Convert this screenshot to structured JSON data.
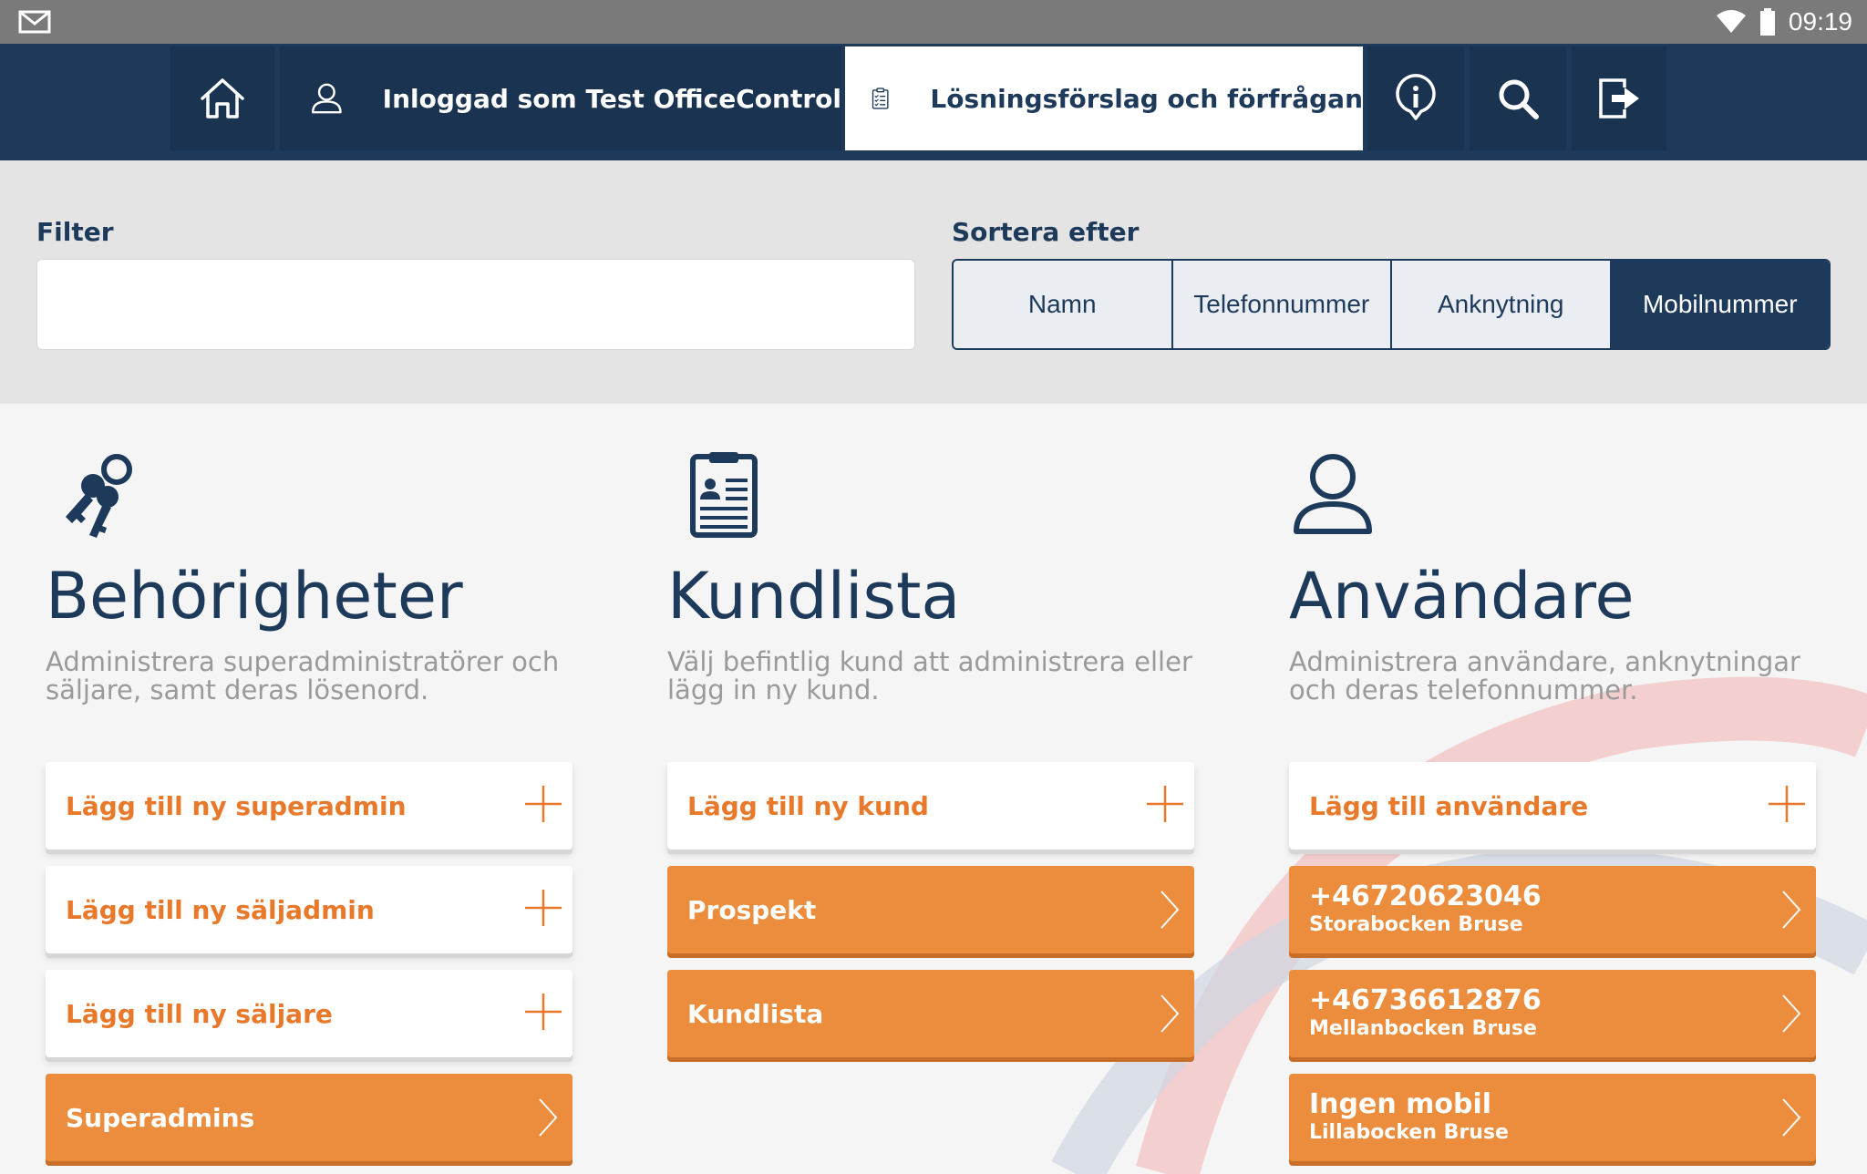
{
  "statusbar": {
    "time": "09:19"
  },
  "nav": {
    "user_label": "Inloggad som Test OfficeControl",
    "active_label": "Lösningsförslag och förfrågan"
  },
  "filter": {
    "label": "Filter",
    "value": "",
    "placeholder": ""
  },
  "sort": {
    "label": "Sortera efter",
    "options": [
      "Namn",
      "Telefonnummer",
      "Anknytning",
      "Mobilnummer"
    ],
    "selected": "Mobilnummer"
  },
  "columns": [
    {
      "title": "Behörigheter",
      "description": "Administrera superadministratörer och säljare, samt deras lösenord.",
      "items": [
        {
          "label": "Lägg till ny superadmin"
        },
        {
          "label": "Lägg till ny säljadmin"
        },
        {
          "label": "Lägg till ny säljare"
        },
        {
          "label": "Superadmins"
        }
      ]
    },
    {
      "title": "Kundlista",
      "description": "Välj befintlig kund att administrera eller lägg in ny kund.",
      "items": [
        {
          "label": "Lägg till ny kund"
        },
        {
          "label": "Prospekt"
        },
        {
          "label": "Kundlista"
        }
      ]
    },
    {
      "title": "Användare",
      "description": "Administrera användare, anknytningar och deras telefonnummer.",
      "items": [
        {
          "label": "Lägg till användare"
        },
        {
          "line1": "+46720623046",
          "line2": "Storabocken Bruse"
        },
        {
          "line1": "+46736612876",
          "line2": "Mellanbocken Bruse"
        },
        {
          "line1": "Ingen mobil",
          "line2": "Lillabocken Bruse"
        }
      ]
    }
  ],
  "colors": {
    "navy": "#1e3a5b",
    "orange": "#ec8c3d",
    "orange_text": "#e8782a"
  }
}
